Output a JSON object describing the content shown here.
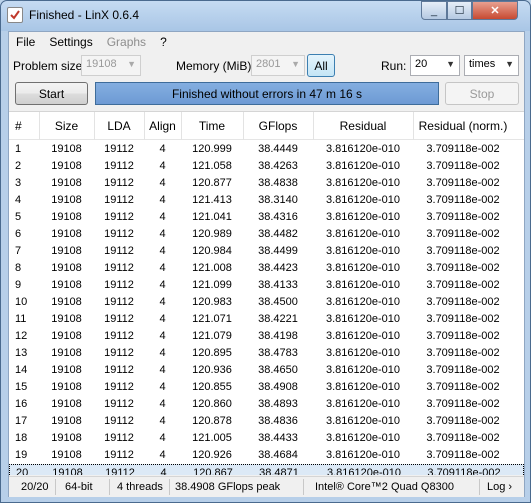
{
  "window": {
    "title": "Finished - LinX 0.6.4",
    "min_glyph": "_",
    "max_glyph": "☐",
    "close_glyph": "✕",
    "icon": "check-icon"
  },
  "menu": [
    {
      "label": "File",
      "enabled": true
    },
    {
      "label": "Settings",
      "enabled": true
    },
    {
      "label": "Graphs",
      "enabled": false
    },
    {
      "label": "?",
      "enabled": true
    }
  ],
  "controls": {
    "problem_size_label": "Problem size:",
    "problem_size_value": "19108",
    "memory_label": "Memory (MiB):",
    "memory_value": "2801",
    "all_button": "All",
    "run_label": "Run:",
    "run_value": "20",
    "run_unit": "times",
    "start_button": "Start",
    "stop_button": "Stop",
    "status_text": "Finished without errors in 47 m 16 s",
    "progress": 1.0
  },
  "table": {
    "columns": [
      "#",
      "Size",
      "LDA",
      "Align",
      "Time",
      "GFlops",
      "Residual",
      "Residual (norm.)"
    ],
    "rows": [
      [
        "1",
        "19108",
        "19112",
        "4",
        "120.999",
        "38.4449",
        "3.816120e-010",
        "3.709118e-002"
      ],
      [
        "2",
        "19108",
        "19112",
        "4",
        "121.058",
        "38.4263",
        "3.816120e-010",
        "3.709118e-002"
      ],
      [
        "3",
        "19108",
        "19112",
        "4",
        "120.877",
        "38.4838",
        "3.816120e-010",
        "3.709118e-002"
      ],
      [
        "4",
        "19108",
        "19112",
        "4",
        "121.413",
        "38.3140",
        "3.816120e-010",
        "3.709118e-002"
      ],
      [
        "5",
        "19108",
        "19112",
        "4",
        "121.041",
        "38.4316",
        "3.816120e-010",
        "3.709118e-002"
      ],
      [
        "6",
        "19108",
        "19112",
        "4",
        "120.989",
        "38.4482",
        "3.816120e-010",
        "3.709118e-002"
      ],
      [
        "7",
        "19108",
        "19112",
        "4",
        "120.984",
        "38.4499",
        "3.816120e-010",
        "3.709118e-002"
      ],
      [
        "8",
        "19108",
        "19112",
        "4",
        "121.008",
        "38.4423",
        "3.816120e-010",
        "3.709118e-002"
      ],
      [
        "9",
        "19108",
        "19112",
        "4",
        "121.099",
        "38.4133",
        "3.816120e-010",
        "3.709118e-002"
      ],
      [
        "10",
        "19108",
        "19112",
        "4",
        "120.983",
        "38.4500",
        "3.816120e-010",
        "3.709118e-002"
      ],
      [
        "11",
        "19108",
        "19112",
        "4",
        "121.071",
        "38.4221",
        "3.816120e-010",
        "3.709118e-002"
      ],
      [
        "12",
        "19108",
        "19112",
        "4",
        "121.079",
        "38.4198",
        "3.816120e-010",
        "3.709118e-002"
      ],
      [
        "13",
        "19108",
        "19112",
        "4",
        "120.895",
        "38.4783",
        "3.816120e-010",
        "3.709118e-002"
      ],
      [
        "14",
        "19108",
        "19112",
        "4",
        "120.936",
        "38.4650",
        "3.816120e-010",
        "3.709118e-002"
      ],
      [
        "15",
        "19108",
        "19112",
        "4",
        "120.855",
        "38.4908",
        "3.816120e-010",
        "3.709118e-002"
      ],
      [
        "16",
        "19108",
        "19112",
        "4",
        "120.860",
        "38.4893",
        "3.816120e-010",
        "3.709118e-002"
      ],
      [
        "17",
        "19108",
        "19112",
        "4",
        "120.878",
        "38.4836",
        "3.816120e-010",
        "3.709118e-002"
      ],
      [
        "18",
        "19108",
        "19112",
        "4",
        "121.005",
        "38.4433",
        "3.816120e-010",
        "3.709118e-002"
      ],
      [
        "19",
        "19108",
        "19112",
        "4",
        "120.926",
        "38.4684",
        "3.816120e-010",
        "3.709118e-002"
      ],
      [
        "20",
        "19108",
        "19112",
        "4",
        "120.867",
        "38.4871",
        "3.816120e-010",
        "3.709118e-002"
      ]
    ],
    "selected_row": 20
  },
  "statusbar": {
    "runs": "20/20",
    "arch": "64-bit",
    "threads": "4 threads",
    "peak": "38.4908 GFlops peak",
    "cpu": "Intel® Core™2 Quad Q8300",
    "log": "Log ›"
  },
  "colors": {
    "status_fill": "#7aa5dc",
    "selected_row": "#dce9f6",
    "close_button": "#c74a32"
  }
}
